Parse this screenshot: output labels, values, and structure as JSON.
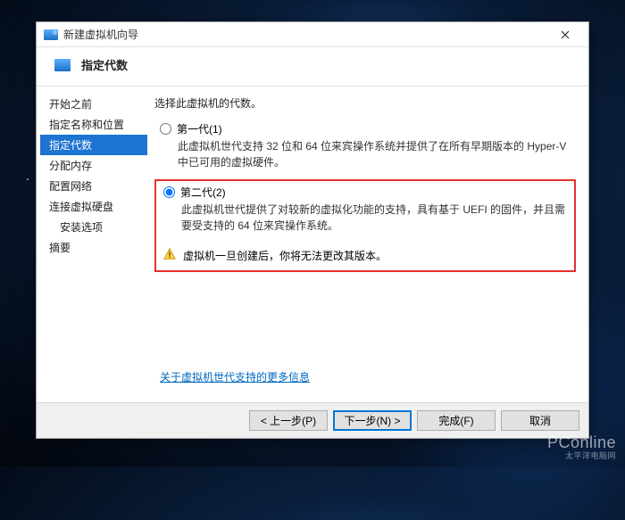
{
  "window": {
    "title": "新建虚拟机向导"
  },
  "header": {
    "title": "指定代数"
  },
  "sidebar": {
    "items": [
      {
        "label": "开始之前",
        "current": false
      },
      {
        "label": "指定名称和位置",
        "current": false
      },
      {
        "label": "指定代数",
        "current": true
      },
      {
        "label": "分配内存",
        "current": false
      },
      {
        "label": "配置网络",
        "current": false
      },
      {
        "label": "连接虚拟硬盘",
        "current": false
      },
      {
        "label": "安装选项",
        "current": false,
        "sub": true
      },
      {
        "label": "摘要",
        "current": false
      }
    ]
  },
  "content": {
    "intro": "选择此虚拟机的代数。",
    "gen1": {
      "label": "第一代(1)",
      "desc": "此虚拟机世代支持 32 位和 64 位来宾操作系统并提供了在所有早期版本的 Hyper-V 中已可用的虚拟硬件。"
    },
    "gen2": {
      "label": "第二代(2)",
      "desc": "此虚拟机世代提供了对较新的虚拟化功能的支持，具有基于 UEFI 的固件，并且需要受支持的 64 位来宾操作系统。"
    },
    "warning": "虚拟机一旦创建后，你将无法更改其版本。",
    "more_link": "关于虚拟机世代支持的更多信息"
  },
  "buttons": {
    "prev": "< 上一步(P)",
    "next": "下一步(N) >",
    "finish": "完成(F)",
    "cancel": "取消"
  },
  "watermark": {
    "brand": "PConline",
    "sub": "太平洋电脑网"
  }
}
